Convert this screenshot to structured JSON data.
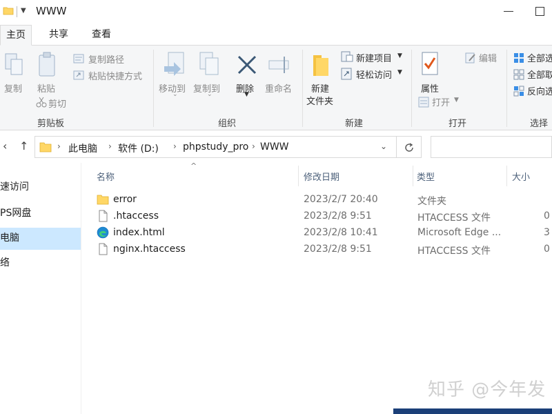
{
  "window": {
    "title": "WWW"
  },
  "ribbon_tabs": [
    "主页",
    "共享",
    "查看"
  ],
  "ribbon": {
    "clipboard": {
      "copy": "复制",
      "paste": "粘贴",
      "copy_path": "复制路径",
      "paste_shortcut": "粘贴快捷方式",
      "cut": "剪切",
      "group": "剪贴板"
    },
    "organize": {
      "move_to": "移动到",
      "copy_to": "复制到",
      "delete": "删除",
      "rename": "重命名",
      "group": "组织"
    },
    "new": {
      "new_folder_line1": "新建",
      "new_folder_line2": "文件夹",
      "new_item": "新建项目",
      "easy_access": "轻松访问",
      "group": "新建"
    },
    "open": {
      "properties": "属性",
      "open": "打开",
      "edit": "编辑",
      "group": "打开"
    },
    "select": {
      "select_all": "全部选",
      "select_none": "全部取",
      "invert": "反向选",
      "group": "选择"
    }
  },
  "address": {
    "crumbs": [
      "此电脑",
      "软件 (D:)",
      "phpstudy_pro",
      "WWW"
    ]
  },
  "nav_pane": {
    "items": [
      "速访问",
      "PS网盘",
      "电脑",
      "络"
    ]
  },
  "columns": {
    "name": "名称",
    "date": "修改日期",
    "type": "类型",
    "size": "大小"
  },
  "files": [
    {
      "name": "error",
      "date": "2023/2/7 20:40",
      "type": "文件夹",
      "size": "",
      "icon": "folder-icon"
    },
    {
      "name": ".htaccess",
      "date": "2023/2/8 9:51",
      "type": "HTACCESS 文件",
      "size": "0",
      "icon": "file-icon"
    },
    {
      "name": "index.html",
      "date": "2023/2/8 10:41",
      "type": "Microsoft Edge ...",
      "size": "3",
      "icon": "edge-icon"
    },
    {
      "name": "nginx.htaccess",
      "date": "2023/2/8 9:51",
      "type": "HTACCESS 文件",
      "size": "0",
      "icon": "file-icon"
    }
  ],
  "watermark": "知乎 @今年发",
  "colors": {
    "accent": "#0078d7",
    "selection": "#cce8ff",
    "folder": "#ffd766"
  }
}
